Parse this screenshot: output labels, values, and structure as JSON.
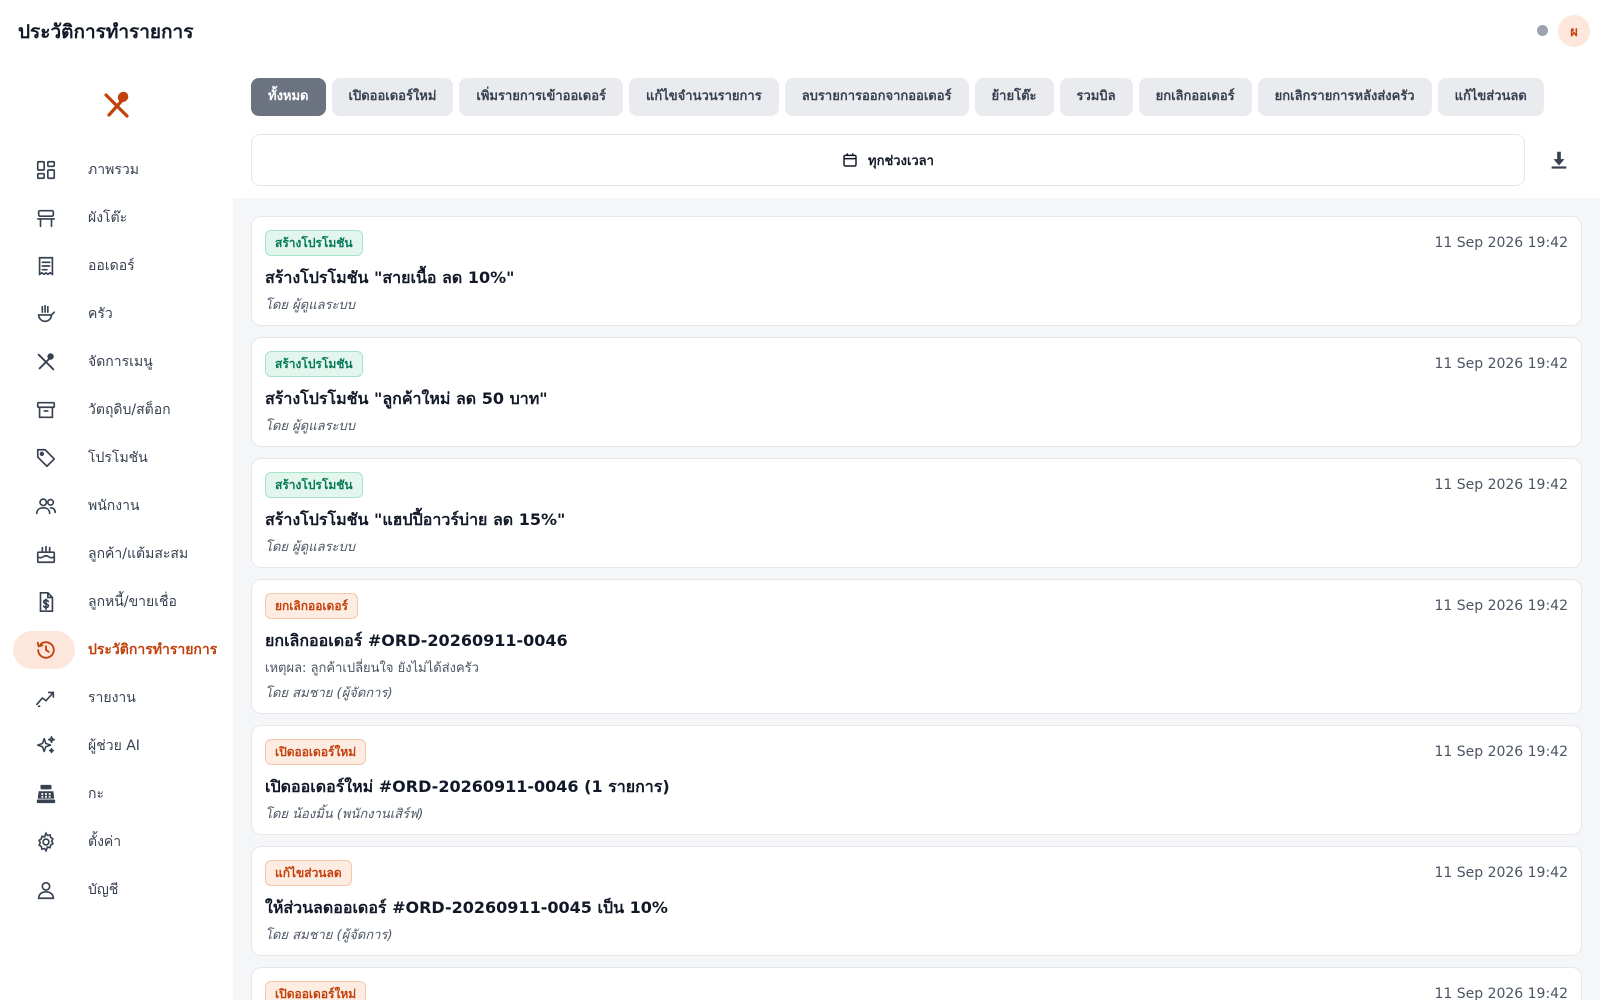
{
  "header": {
    "title": "ประวัติการทำรายการ",
    "avatar_initial": "ผ",
    "status_color": "#9ca3af"
  },
  "sidebar": {
    "logo_icon": "fork-spoon-icon",
    "items": [
      {
        "label": "ภาพรวม",
        "icon": "dashboard-icon"
      },
      {
        "label": "ผังโต๊ะ",
        "icon": "table-icon"
      },
      {
        "label": "ออเดอร์",
        "icon": "receipt-icon"
      },
      {
        "label": "ครัว",
        "icon": "kitchen-icon"
      },
      {
        "label": "จัดการเมนู",
        "icon": "utensils-icon"
      },
      {
        "label": "วัตถุดิบ/สต็อก",
        "icon": "archive-icon"
      },
      {
        "label": "โปรโมชัน",
        "icon": "tag-icon"
      },
      {
        "label": "พนักงาน",
        "icon": "people-icon"
      },
      {
        "label": "ลูกค้า/แต้มสะสม",
        "icon": "cake-icon"
      },
      {
        "label": "ลูกหนี้/ขายเชื่อ",
        "icon": "invoice-dollar-icon"
      },
      {
        "label": "ประวัติการทำรายการ",
        "icon": "history-icon",
        "active": true
      },
      {
        "label": "รายงาน",
        "icon": "trend-icon"
      },
      {
        "label": "ผู้ช่วย AI",
        "icon": "sparkles-icon"
      },
      {
        "label": "กะ",
        "icon": "cash-register-icon"
      },
      {
        "label": "ตั้งค่า",
        "icon": "gear-icon"
      },
      {
        "label": "บัญชี",
        "icon": "user-icon"
      }
    ]
  },
  "filters": {
    "tabs": [
      {
        "label": "ทั้งหมด",
        "active": true
      },
      {
        "label": "เปิดออเดอร์ใหม่"
      },
      {
        "label": "เพิ่มรายการเข้าออเดอร์"
      },
      {
        "label": "แก้ไขจำนวนรายการ"
      },
      {
        "label": "ลบรายการออกจากออเดอร์"
      },
      {
        "label": "ย้ายโต๊ะ"
      },
      {
        "label": "รวมบิล"
      },
      {
        "label": "ยกเลิกออเดอร์"
      },
      {
        "label": "ยกเลิกรายการหลังส่งครัว"
      },
      {
        "label": "แก้ไขส่วนลด"
      }
    ],
    "date_range_label": "ทุกช่วงเวลา",
    "calendar_icon": "calendar-icon",
    "download_icon": "download-icon"
  },
  "logs": [
    {
      "badge": "สร้างโปรโมชัน",
      "badge_color": "green",
      "timestamp": "11 Sep 2026 19:42",
      "title": "สร้างโปรโมชัน \"สายเนื้อ ลด 10%\"",
      "by": "โดย ผู้ดูแลระบบ"
    },
    {
      "badge": "สร้างโปรโมชัน",
      "badge_color": "green",
      "timestamp": "11 Sep 2026 19:42",
      "title": "สร้างโปรโมชัน \"ลูกค้าใหม่ ลด 50 บาท\"",
      "by": "โดย ผู้ดูแลระบบ"
    },
    {
      "badge": "สร้างโปรโมชัน",
      "badge_color": "green",
      "timestamp": "11 Sep 2026 19:42",
      "title": "สร้างโปรโมชัน \"แฮปปี้อาวร์บ่าย ลด 15%\"",
      "by": "โดย ผู้ดูแลระบบ"
    },
    {
      "badge": "ยกเลิกออเดอร์",
      "badge_color": "orange",
      "timestamp": "11 Sep 2026 19:42",
      "title": "ยกเลิกออเดอร์ #ORD-20260911-0046",
      "reason": "เหตุผล: ลูกค้าเปลี่ยนใจ ยังไม่ได้ส่งครัว",
      "by": "โดย สมชาย (ผู้จัดการ)"
    },
    {
      "badge": "เปิดออเดอร์ใหม่",
      "badge_color": "orange",
      "timestamp": "11 Sep 2026 19:42",
      "title": "เปิดออเดอร์ใหม่ #ORD-20260911-0046 (1 รายการ)",
      "by": "โดย น้องมิ้น (พนักงานเสิร์ฟ)"
    },
    {
      "badge": "แก้ไขส่วนลด",
      "badge_color": "orange",
      "timestamp": "11 Sep 2026 19:42",
      "title": "ให้ส่วนลดออเดอร์ #ORD-20260911-0045 เป็น 10%",
      "by": "โดย สมชาย (ผู้จัดการ)"
    },
    {
      "badge": "เปิดออเดอร์ใหม่",
      "badge_color": "orange",
      "timestamp": "11 Sep 2026 19:42"
    }
  ],
  "colors": {
    "accent": "#c2410c",
    "accent_soft": "#fde7dc",
    "success": "#047857",
    "tab_active": "#6b7280"
  }
}
